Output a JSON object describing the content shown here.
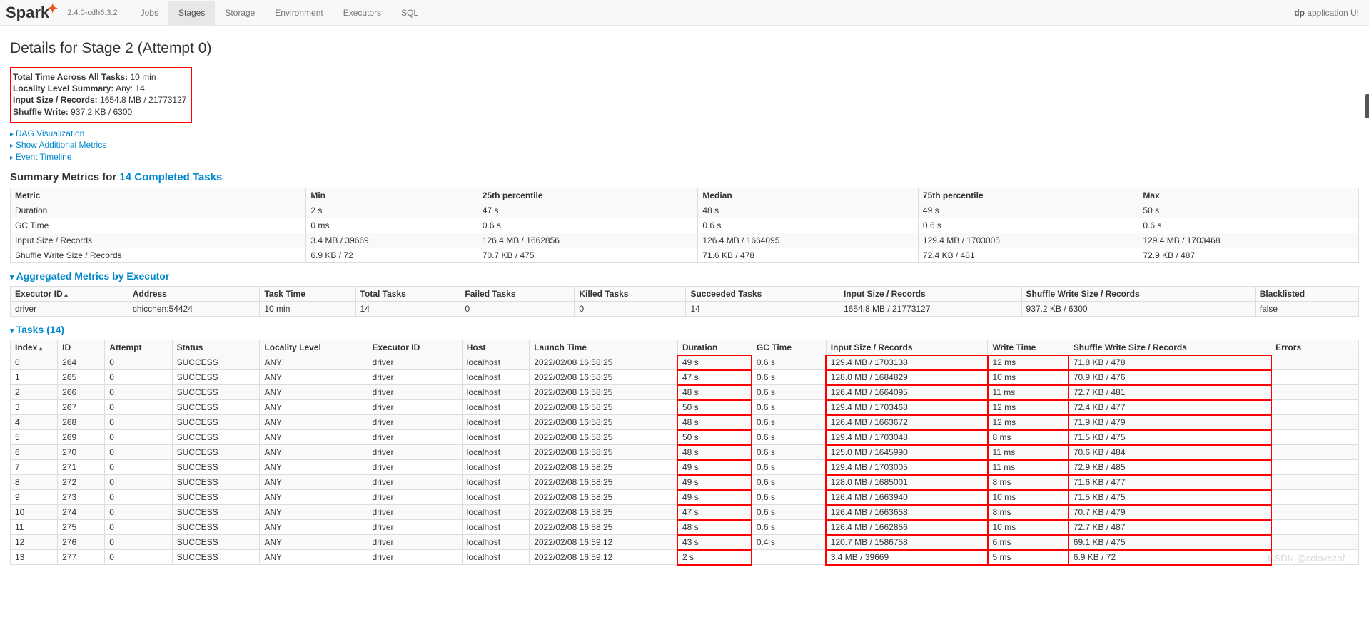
{
  "brand": {
    "name": "Spark",
    "version": "2.4.0-cdh6.3.2"
  },
  "nav": {
    "tabs": [
      "Jobs",
      "Stages",
      "Storage",
      "Environment",
      "Executors",
      "SQL"
    ],
    "active": "Stages",
    "right_bold": "dp",
    "right_rest": " application UI"
  },
  "page_title": "Details for Stage 2 (Attempt 0)",
  "stats": {
    "total_time_label": "Total Time Across All Tasks:",
    "total_time_value": " 10 min",
    "locality_label": "Locality Level Summary:",
    "locality_value": " Any: 14",
    "input_label": "Input Size / Records:",
    "input_value": " 1654.8 MB / 21773127",
    "shuffle_label": "Shuffle Write:",
    "shuffle_value": " 937.2 KB / 6300"
  },
  "collapsibles": [
    "DAG Visualization",
    "Show Additional Metrics",
    "Event Timeline"
  ],
  "summary": {
    "title_prefix": "Summary Metrics for ",
    "title_link": "14 Completed Tasks",
    "columns": [
      "Metric",
      "Min",
      "25th percentile",
      "Median",
      "75th percentile",
      "Max"
    ],
    "rows": [
      [
        "Duration",
        "2 s",
        "47 s",
        "48 s",
        "49 s",
        "50 s"
      ],
      [
        "GC Time",
        "0 ms",
        "0.6 s",
        "0.6 s",
        "0.6 s",
        "0.6 s"
      ],
      [
        "Input Size / Records",
        "3.4 MB / 39669",
        "126.4 MB / 1662856",
        "126.4 MB / 1664095",
        "129.4 MB / 1703005",
        "129.4 MB / 1703468"
      ],
      [
        "Shuffle Write Size / Records",
        "6.9 KB / 72",
        "70.7 KB / 475",
        "71.6 KB / 478",
        "72.4 KB / 481",
        "72.9 KB / 487"
      ]
    ]
  },
  "agg": {
    "title": "Aggregated Metrics by Executor",
    "columns": [
      "Executor ID",
      "Address",
      "Task Time",
      "Total Tasks",
      "Failed Tasks",
      "Killed Tasks",
      "Succeeded Tasks",
      "Input Size / Records",
      "Shuffle Write Size / Records",
      "Blacklisted"
    ],
    "rows": [
      [
        "driver",
        "chicchen:54424",
        "10 min",
        "14",
        "0",
        "0",
        "14",
        "1654.8 MB / 21773127",
        "937.2 KB / 6300",
        "false"
      ]
    ]
  },
  "tasks": {
    "title": "Tasks (14)",
    "columns": [
      "Index",
      "ID",
      "Attempt",
      "Status",
      "Locality Level",
      "Executor ID",
      "Host",
      "Launch Time",
      "Duration",
      "GC Time",
      "Input Size / Records",
      "Write Time",
      "Shuffle Write Size / Records",
      "Errors"
    ],
    "red_cols": [
      8,
      10,
      11,
      12
    ],
    "rows": [
      [
        "0",
        "264",
        "0",
        "SUCCESS",
        "ANY",
        "driver",
        "localhost",
        "2022/02/08 16:58:25",
        "49 s",
        "0.6 s",
        "129.4 MB / 1703138",
        "12 ms",
        "71.8 KB / 478",
        ""
      ],
      [
        "1",
        "265",
        "0",
        "SUCCESS",
        "ANY",
        "driver",
        "localhost",
        "2022/02/08 16:58:25",
        "47 s",
        "0.6 s",
        "128.0 MB / 1684829",
        "10 ms",
        "70.9 KB / 476",
        ""
      ],
      [
        "2",
        "266",
        "0",
        "SUCCESS",
        "ANY",
        "driver",
        "localhost",
        "2022/02/08 16:58:25",
        "48 s",
        "0.6 s",
        "126.4 MB / 1664095",
        "11 ms",
        "72.7 KB / 481",
        ""
      ],
      [
        "3",
        "267",
        "0",
        "SUCCESS",
        "ANY",
        "driver",
        "localhost",
        "2022/02/08 16:58:25",
        "50 s",
        "0.6 s",
        "129.4 MB / 1703468",
        "12 ms",
        "72.4 KB / 477",
        ""
      ],
      [
        "4",
        "268",
        "0",
        "SUCCESS",
        "ANY",
        "driver",
        "localhost",
        "2022/02/08 16:58:25",
        "48 s",
        "0.6 s",
        "126.4 MB / 1663672",
        "12 ms",
        "71.9 KB / 479",
        ""
      ],
      [
        "5",
        "269",
        "0",
        "SUCCESS",
        "ANY",
        "driver",
        "localhost",
        "2022/02/08 16:58:25",
        "50 s",
        "0.6 s",
        "129.4 MB / 1703048",
        "8 ms",
        "71.5 KB / 475",
        ""
      ],
      [
        "6",
        "270",
        "0",
        "SUCCESS",
        "ANY",
        "driver",
        "localhost",
        "2022/02/08 16:58:25",
        "48 s",
        "0.6 s",
        "125.0 MB / 1645990",
        "11 ms",
        "70.6 KB / 484",
        ""
      ],
      [
        "7",
        "271",
        "0",
        "SUCCESS",
        "ANY",
        "driver",
        "localhost",
        "2022/02/08 16:58:25",
        "49 s",
        "0.6 s",
        "129.4 MB / 1703005",
        "11 ms",
        "72.9 KB / 485",
        ""
      ],
      [
        "8",
        "272",
        "0",
        "SUCCESS",
        "ANY",
        "driver",
        "localhost",
        "2022/02/08 16:58:25",
        "49 s",
        "0.6 s",
        "128.0 MB / 1685001",
        "8 ms",
        "71.6 KB / 477",
        ""
      ],
      [
        "9",
        "273",
        "0",
        "SUCCESS",
        "ANY",
        "driver",
        "localhost",
        "2022/02/08 16:58:25",
        "49 s",
        "0.6 s",
        "126.4 MB / 1663940",
        "10 ms",
        "71.5 KB / 475",
        ""
      ],
      [
        "10",
        "274",
        "0",
        "SUCCESS",
        "ANY",
        "driver",
        "localhost",
        "2022/02/08 16:58:25",
        "47 s",
        "0.6 s",
        "126.4 MB / 1663658",
        "8 ms",
        "70.7 KB / 479",
        ""
      ],
      [
        "11",
        "275",
        "0",
        "SUCCESS",
        "ANY",
        "driver",
        "localhost",
        "2022/02/08 16:58:25",
        "48 s",
        "0.6 s",
        "126.4 MB / 1662856",
        "10 ms",
        "72.7 KB / 487",
        ""
      ],
      [
        "12",
        "276",
        "0",
        "SUCCESS",
        "ANY",
        "driver",
        "localhost",
        "2022/02/08 16:59:12",
        "43 s",
        "0.4 s",
        "120.7 MB / 1586758",
        "6 ms",
        "69.1 KB / 475",
        ""
      ],
      [
        "13",
        "277",
        "0",
        "SUCCESS",
        "ANY",
        "driver",
        "localhost",
        "2022/02/08 16:59:12",
        "2 s",
        "",
        "3.4 MB / 39669",
        "5 ms",
        "6.9 KB / 72",
        ""
      ]
    ]
  },
  "watermark": "CSDN @cclovezbf"
}
